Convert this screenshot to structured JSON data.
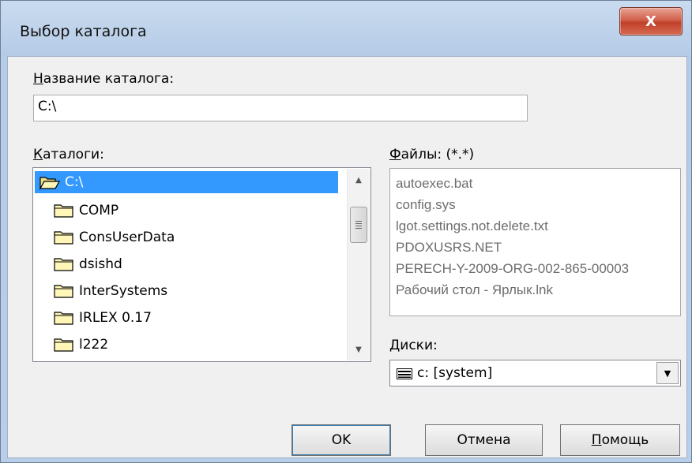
{
  "window": {
    "title": "Выбор каталога",
    "close_label": "X"
  },
  "dir_name": {
    "label_accel": "Н",
    "label_rest": "азвание каталога:",
    "value": "C:\\"
  },
  "directories": {
    "label_accel": "К",
    "label_rest": "аталоги:",
    "items": [
      {
        "label": "C:\\",
        "selected": true,
        "icon": "open-folder-icon"
      },
      {
        "label": "COMP",
        "icon": "folder-icon"
      },
      {
        "label": "ConsUserData",
        "icon": "folder-icon"
      },
      {
        "label": "dsishd",
        "icon": "folder-icon"
      },
      {
        "label": "InterSystems",
        "icon": "folder-icon"
      },
      {
        "label": "IRLEX 0.17",
        "icon": "folder-icon"
      },
      {
        "label": "l222",
        "icon": "folder-icon"
      }
    ]
  },
  "files": {
    "label_accel": "Ф",
    "label_rest": "айлы: (*.*)",
    "items": [
      "autoexec.bat",
      "config.sys",
      "lgot.settings.not.delete.txt",
      "PDOXUSRS.NET",
      "PERECH-Y-2009-ORG-002-865-00003",
      "Рабочий стол - Ярлык.lnk"
    ]
  },
  "drives": {
    "label_accel": "Д",
    "label_rest": "иски:",
    "value": "c: [system]",
    "icon": "drive-icon"
  },
  "buttons": {
    "ok": "OK",
    "cancel": "Отмена",
    "help_accel": "П",
    "help_rest": "омощь"
  }
}
